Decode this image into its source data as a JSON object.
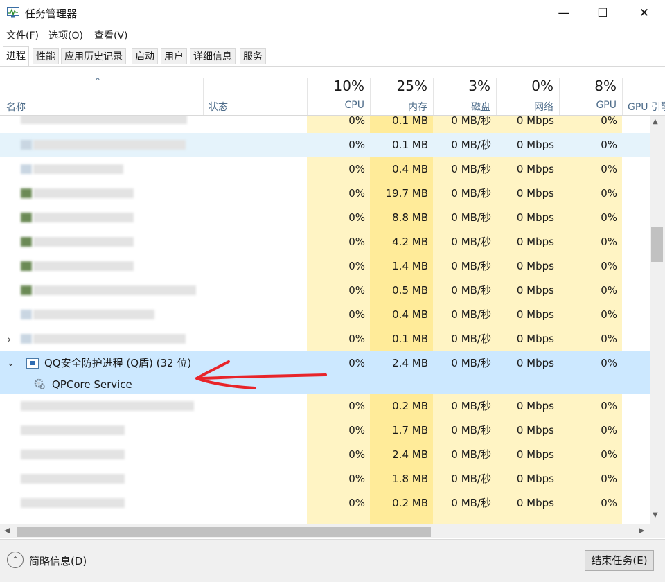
{
  "window": {
    "title": "任务管理器",
    "controls": {
      "minimize": "—",
      "maximize": "☐",
      "close": "✕"
    }
  },
  "menu": [
    "文件(F)",
    "选项(O)",
    "查看(V)"
  ],
  "tabs": [
    "进程",
    "性能",
    "应用历史记录",
    "启动",
    "用户",
    "详细信息",
    "服务"
  ],
  "active_tab": "进程",
  "columns": {
    "name": "名称",
    "status": "状态",
    "cpu": {
      "pct": "10%",
      "label": "CPU"
    },
    "memory": {
      "pct": "25%",
      "label": "内存"
    },
    "disk": {
      "pct": "3%",
      "label": "磁盘"
    },
    "network": {
      "pct": "0%",
      "label": "网络"
    },
    "gpu": {
      "pct": "8%",
      "label": "GPU"
    },
    "gpu_engine": "GPU 引擎"
  },
  "rows_top": [
    {
      "cpu": "0%",
      "mem": "0.1 MB",
      "disk": "0 MB/秒",
      "net": "0 Mbps",
      "gpu": "0%"
    },
    {
      "cpu": "0%",
      "mem": "0.1 MB",
      "disk": "0 MB/秒",
      "net": "0 Mbps",
      "gpu": "0%"
    },
    {
      "cpu": "0%",
      "mem": "0.4 MB",
      "disk": "0 MB/秒",
      "net": "0 Mbps",
      "gpu": "0%"
    },
    {
      "cpu": "0%",
      "mem": "19.7 MB",
      "disk": "0 MB/秒",
      "net": "0 Mbps",
      "gpu": "0%"
    },
    {
      "cpu": "0%",
      "mem": "8.8 MB",
      "disk": "0 MB/秒",
      "net": "0 Mbps",
      "gpu": "0%"
    },
    {
      "cpu": "0%",
      "mem": "4.2 MB",
      "disk": "0 MB/秒",
      "net": "0 Mbps",
      "gpu": "0%"
    },
    {
      "cpu": "0%",
      "mem": "1.4 MB",
      "disk": "0 MB/秒",
      "net": "0 Mbps",
      "gpu": "0%"
    },
    {
      "cpu": "0%",
      "mem": "0.5 MB",
      "disk": "0 MB/秒",
      "net": "0 Mbps",
      "gpu": "0%"
    },
    {
      "cpu": "0%",
      "mem": "0.4 MB",
      "disk": "0 MB/秒",
      "net": "0 Mbps",
      "gpu": "0%"
    },
    {
      "cpu": "0%",
      "mem": "0.1 MB",
      "disk": "0 MB/秒",
      "net": "0 Mbps",
      "gpu": "0%"
    }
  ],
  "selected_process": {
    "name": "QQ安全防护进程 (Q盾) (32 位)",
    "cpu": "0%",
    "mem": "2.4 MB",
    "disk": "0 MB/秒",
    "net": "0 Mbps",
    "gpu": "0%",
    "child": "QPCore Service"
  },
  "rows_bottom": [
    {
      "cpu": "0%",
      "mem": "0.2 MB",
      "disk": "0 MB/秒",
      "net": "0 Mbps",
      "gpu": "0%"
    },
    {
      "cpu": "0%",
      "mem": "1.7 MB",
      "disk": "0 MB/秒",
      "net": "0 Mbps",
      "gpu": "0%"
    },
    {
      "cpu": "0%",
      "mem": "2.4 MB",
      "disk": "0 MB/秒",
      "net": "0 Mbps",
      "gpu": "0%"
    },
    {
      "cpu": "0%",
      "mem": "1.8 MB",
      "disk": "0 MB/秒",
      "net": "0 Mbps",
      "gpu": "0%"
    },
    {
      "cpu": "0%",
      "mem": "0.2 MB",
      "disk": "0 MB/秒",
      "net": "0 Mbps",
      "gpu": "0%"
    }
  ],
  "footer": {
    "fewer_details": "简略信息(D)",
    "end_task": "结束任务(E)"
  },
  "colors": {
    "heat_light": "#fff4c4",
    "heat_medium": "#ffeb99",
    "selected_row": "#cce8ff",
    "annotation_arrow": "#e8242a"
  }
}
